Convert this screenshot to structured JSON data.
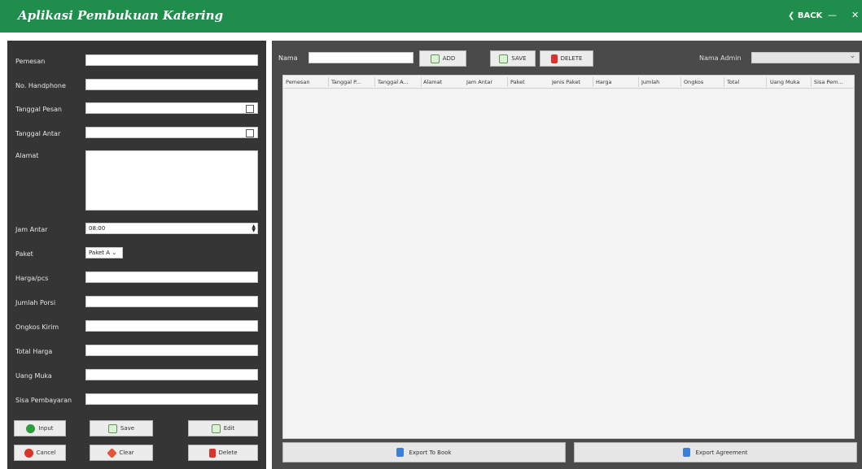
{
  "window": {
    "title": "Aplikasi Pembukuan Katering",
    "back_label": "❮ BACK",
    "minimize_label": "—",
    "close_label": "✕",
    "accent_color": "#1f8e4d"
  },
  "form": {
    "fields": [
      {
        "label": "Pemesan",
        "type": "text",
        "value": ""
      },
      {
        "label": "No. Handphone",
        "type": "text",
        "value": ""
      },
      {
        "label": "Tanggal Pesan",
        "type": "date",
        "value": ""
      },
      {
        "label": "Tanggal Antar",
        "type": "date",
        "value": ""
      },
      {
        "label": "Alamat",
        "type": "textarea",
        "value": ""
      },
      {
        "label": "Jam Antar",
        "type": "time",
        "value": "08:00"
      },
      {
        "label": "Paket",
        "type": "select",
        "value": "Paket A"
      },
      {
        "label": "Harga/pcs",
        "type": "text",
        "value": ""
      },
      {
        "label": "Jumlah Porsi",
        "type": "text",
        "value": ""
      },
      {
        "label": "Ongkos Kirim",
        "type": "text",
        "value": ""
      },
      {
        "label": "Total Harga",
        "type": "text",
        "value": ""
      },
      {
        "label": "Uang Muka",
        "type": "text",
        "value": ""
      },
      {
        "label": "Sisa Pembayaran",
        "type": "text",
        "value": ""
      }
    ],
    "buttons": {
      "input": "Input",
      "save": "Save",
      "edit": "Edit",
      "cancel": "Cancel",
      "clear": "Clear",
      "delete": "Delete"
    }
  },
  "toolbar": {
    "nama_label": "Nama",
    "add_label": "ADD",
    "save_label": "SAVE",
    "delete_label": "DELETE",
    "admin_label": "Nama Admin"
  },
  "table": {
    "columns": [
      "Pemesan",
      "Tanggal P...",
      "Tanggal A...",
      "Alamat",
      "Jam Antar",
      "Paket",
      "Jenis Paket",
      "Harga",
      "Jumlah",
      "Ongkos",
      "Total",
      "Uang Muka",
      "Sisa Pem..."
    ],
    "rows": []
  },
  "bottom": {
    "export_book": "Export To Book",
    "export_agreement": "Export Agreement"
  },
  "icons": {
    "input": "plus-circle-icon",
    "save": "floppy-icon",
    "edit": "edit-icon",
    "cancel": "cancel-circle-icon",
    "clear": "eraser-icon",
    "delete": "trash-icon",
    "export": "document-icon"
  }
}
